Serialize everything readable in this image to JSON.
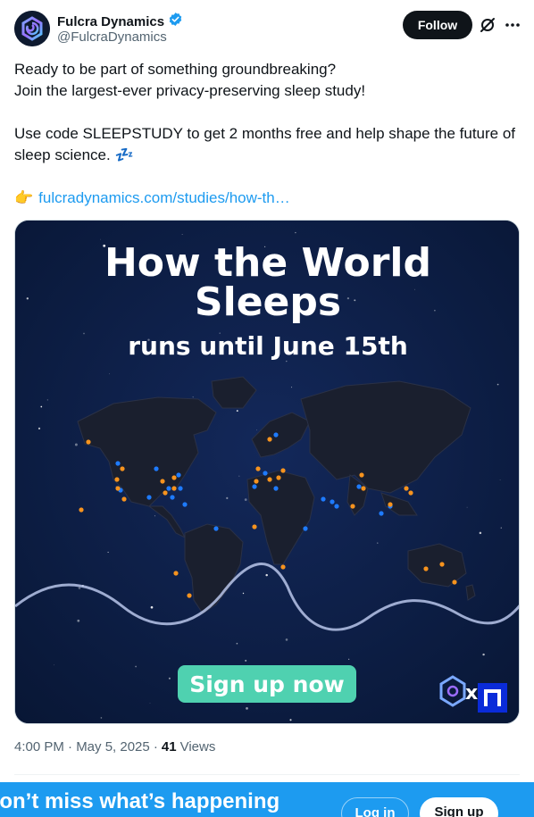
{
  "author": {
    "display_name": "Fulcra Dynamics",
    "handle": "@FulcraDynamics",
    "verified_icon": "verified-badge-icon"
  },
  "actions": {
    "follow_label": "Follow",
    "grok_icon": "grok-icon",
    "more_icon": "more-icon"
  },
  "tweet": {
    "line1": "Ready to be part of something groundbreaking?",
    "line2": "Join the largest-ever privacy-preserving sleep study!",
    "line3": "Use code SLEEPSTUDY to get 2 months free and help shape the future of sleep science.",
    "sleep_emoji": "💤",
    "point_emoji": "👉",
    "link_text": "fulcradynamics.com/studies/how-th…"
  },
  "media": {
    "title_line1": "How the World",
    "title_line2": "Sleeps",
    "subtitle": "runs until June 15th",
    "cta": "Sign up now",
    "partner_x": "x",
    "colors": {
      "background": "#0a1a3c",
      "cta": "#4fd1b0",
      "dot_orange": "#f7931e",
      "dot_blue": "#1e7bff"
    }
  },
  "meta": {
    "time": "4:00 PM · May 5, 2025 ·",
    "views_count": "41",
    "views_label": "Views"
  },
  "bottom_bar": {
    "title": "Don’t miss what’s happening",
    "login_label": "Log in",
    "signup_label": "Sign up"
  }
}
